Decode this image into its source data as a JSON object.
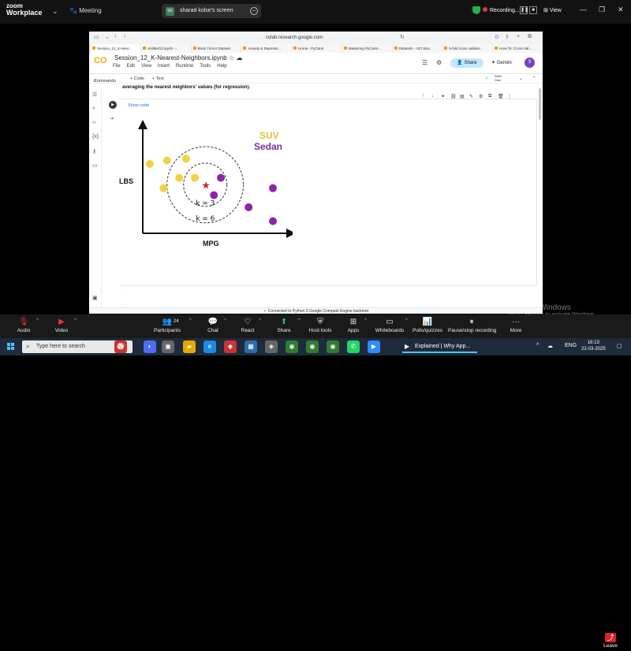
{
  "zoom": {
    "logo_line1": "zoom",
    "logo_line2": "Workplace",
    "meeting_label": "Meeting",
    "screen_share_label": "sharad kolse's screen",
    "screen_share_avatar": "SK",
    "recording_label": "Recording...",
    "view_label": "View",
    "toolbar": [
      {
        "label": "Audio",
        "icon": "mic-muted-icon"
      },
      {
        "label": "Video",
        "icon": "video-off-icon"
      },
      {
        "label": "Participants",
        "icon": "participants-icon",
        "count": "24"
      },
      {
        "label": "Chat",
        "icon": "chat-icon"
      },
      {
        "label": "React",
        "icon": "heart-icon"
      },
      {
        "label": "Share",
        "icon": "share-icon"
      },
      {
        "label": "Host tools",
        "icon": "shield-icon"
      },
      {
        "label": "Apps",
        "icon": "apps-icon"
      },
      {
        "label": "Whiteboards",
        "icon": "whiteboard-icon"
      },
      {
        "label": "Polls/quizzes",
        "icon": "poll-icon"
      },
      {
        "label": "Pause/stop recording",
        "icon": "pause-icon"
      },
      {
        "label": "More",
        "icon": "more-icon"
      }
    ],
    "leave_label": "Leave"
  },
  "browser": {
    "url": "colab.research.google.com",
    "tabs": [
      "Session_12_K-Near...",
      "Untitled12.ipynb -...",
      "Brain Tumor Dataset",
      "Anxiety & Depressi...",
      "Home - PyCaret",
      "Mastering PyCaret...",
      "Datasets - UCI Mac...",
      "k-fold cross validati...",
      "How-To: Cross-Val..."
    ]
  },
  "colab": {
    "logo": "CO",
    "notebook_title": "Session_12_K-Nearest-Neighbors.ipynb",
    "menu": [
      "File",
      "Edit",
      "View",
      "Insert",
      "Runtime",
      "Tools",
      "Help"
    ],
    "commands_label": "Commands",
    "add_code_label": "+ Code",
    "add_text_label": "+ Text",
    "ram_label": "RAM",
    "disk_label": "Disk",
    "share_label": "Share",
    "gemini_label": "Gemini",
    "user_initial": "S",
    "description": "averaging the nearest neighbors' values (for regression).",
    "show_code_label": "Show code",
    "status_text": "Connected to Python 3 Google Compute Engine backend"
  },
  "chart_data": {
    "type": "scatter",
    "title": "",
    "xlabel": "MPG",
    "ylabel": "LBS",
    "legend": [
      {
        "name": "SUV",
        "color": "#d9c33a"
      },
      {
        "name": "Sedan",
        "color": "#7a2d9c"
      }
    ],
    "query_point": {
      "x": 3.6,
      "y": 2.8,
      "color": "#c62828"
    },
    "circles": [
      {
        "label": "k = 3",
        "radius": 1.25
      },
      {
        "label": "k = 6",
        "radius": 2.2
      }
    ],
    "series": [
      {
        "name": "SUV",
        "color": "#f5d142",
        "points": [
          [
            0.4,
            4.0
          ],
          [
            1.4,
            4.2
          ],
          [
            2.5,
            4.3
          ],
          [
            2.1,
            3.2
          ],
          [
            1.2,
            2.6
          ],
          [
            3.0,
            3.2
          ]
        ]
      },
      {
        "name": "Sedan",
        "color": "#8e24aa",
        "points": [
          [
            4.5,
            3.2
          ],
          [
            4.1,
            2.2
          ],
          [
            6.1,
            1.5
          ],
          [
            7.5,
            2.6
          ],
          [
            7.5,
            0.7
          ]
        ]
      }
    ],
    "xlim": [
      0,
      8
    ],
    "ylim": [
      0,
      5
    ]
  },
  "windows": {
    "activate_title": "Activate Windows",
    "activate_sub": "Go to Settings to activate Windows.",
    "search_placeholder": "Type here to search",
    "active_app": "Explained | Why App...",
    "lang": "ENG",
    "time": "16:13",
    "date": "22-03-2025"
  }
}
